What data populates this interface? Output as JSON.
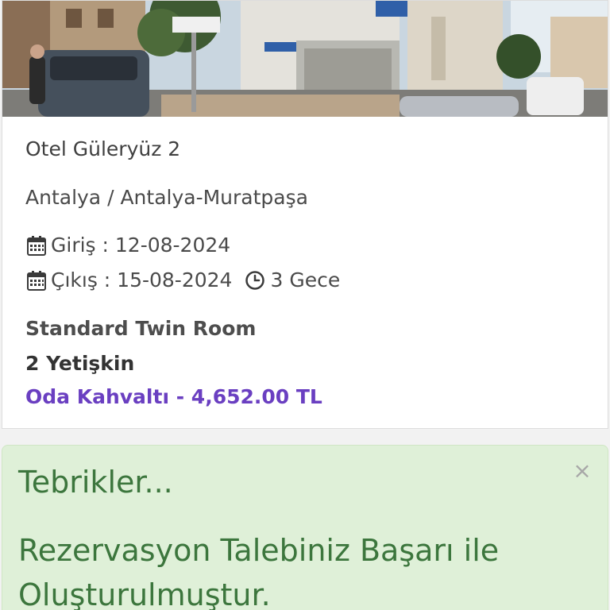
{
  "hotel": {
    "photo_icon": "hotel-street-photo",
    "name": "Otel Güleryüz 2",
    "location": "Antalya / Antalya-Muratpaşa"
  },
  "stay": {
    "checkin_label": "Giriş : 12-08-2024",
    "checkout_label": "Çıkış : 15-08-2024",
    "nights_label": "3 Gece",
    "calendar_icon": "calendar-icon",
    "clock_icon": "clock-icon"
  },
  "room": {
    "type": "Standard Twin Room",
    "guests": "2 Yetişkin",
    "board_and_price": "Oda Kahvaltı - 4,652.00 TL"
  },
  "alert": {
    "title": "Tebrikler...",
    "message": "Rezervasyon Talebiniz Başarı ile Oluşturulmuştur.",
    "close_glyph": "×"
  },
  "colors": {
    "price": "#6a3fc1",
    "alert_bg": "#dff0d8",
    "alert_text": "#3c763d"
  }
}
